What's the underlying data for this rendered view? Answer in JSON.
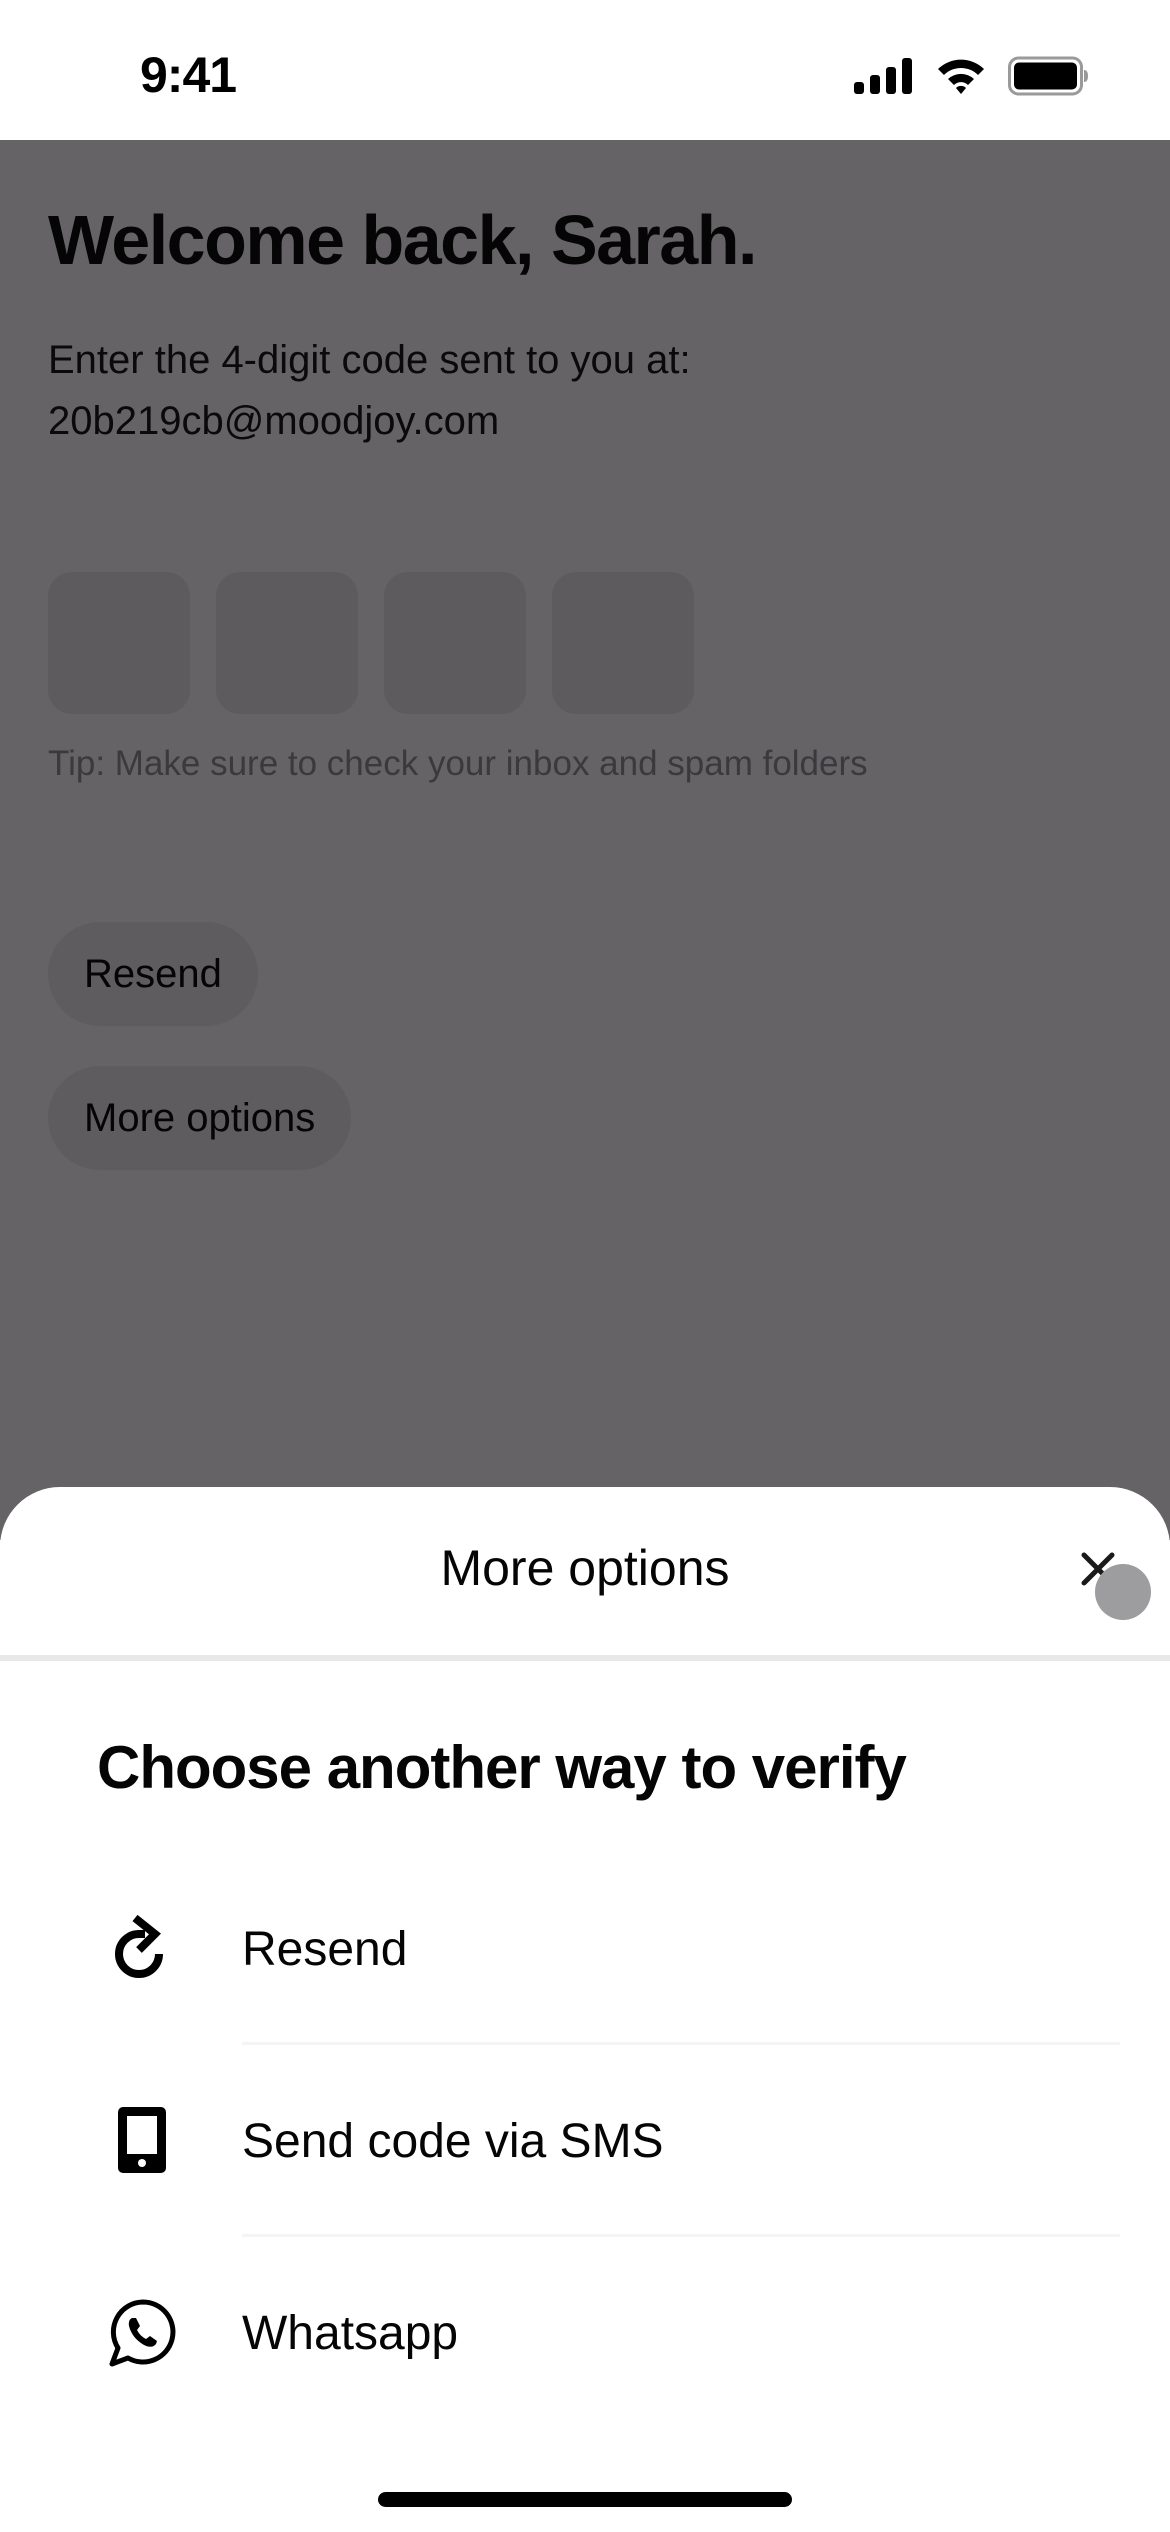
{
  "status_bar": {
    "time": "9:41",
    "icons": [
      "cellular-signal-icon",
      "wifi-icon",
      "battery-icon"
    ]
  },
  "screen": {
    "title": "Welcome back, Sarah.",
    "instruction_line1": "Enter the 4-digit code sent to you at:",
    "email": "20b219cb@moodjoy.com",
    "code_digits": [
      "",
      "",
      "",
      ""
    ],
    "tip": "Tip: Make sure to check your inbox and spam folders",
    "resend_label": "Resend",
    "more_options_label": "More options",
    "overlay_color": "#656366"
  },
  "sheet": {
    "title": "More options",
    "close_icon": "close-icon",
    "heading": "Choose another way to verify",
    "options": [
      {
        "label": "Resend",
        "icon": "refresh-icon"
      },
      {
        "label": "Send code via SMS",
        "icon": "smartphone-icon"
      },
      {
        "label": "Whatsapp",
        "icon": "whatsapp-icon"
      }
    ]
  }
}
